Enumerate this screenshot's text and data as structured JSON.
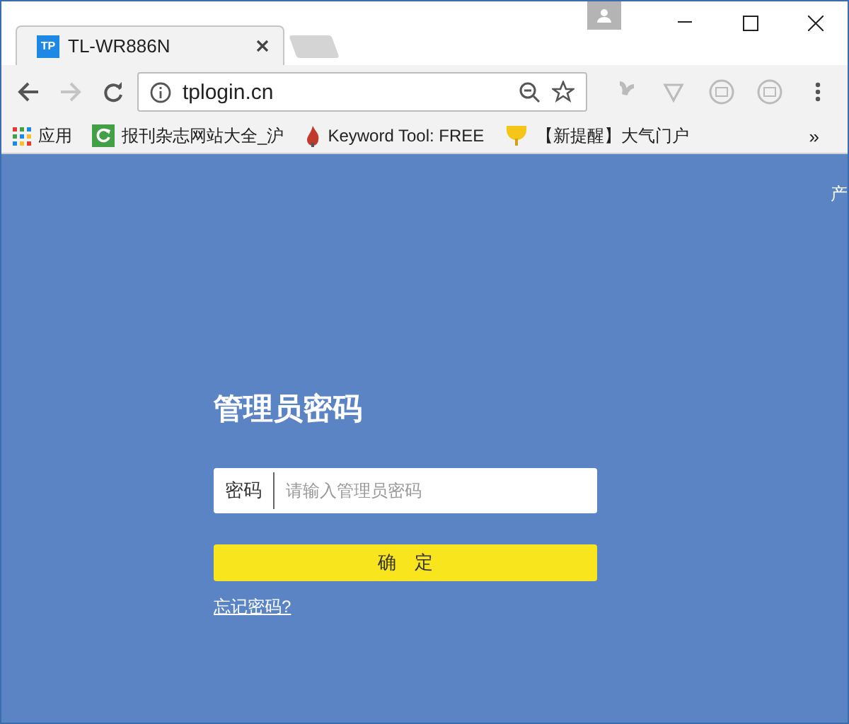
{
  "tabs": [
    {
      "label": "TL-WR886N",
      "favicon": "TP",
      "selected": true
    }
  ],
  "toolbar": {
    "back_disabled": false,
    "forward_disabled": true,
    "url": "tplogin.cn"
  },
  "bookmarks": [
    {
      "kind": "apps",
      "label": "应用"
    },
    {
      "kind": "refresh",
      "label": "报刊杂志网站大全_沪"
    },
    {
      "kind": "flame",
      "label": "Keyword Tool: FREE"
    },
    {
      "kind": "trophy",
      "label": "【新提醒】大气门户"
    }
  ],
  "bookmarks_more": "»",
  "page": {
    "corner_text": "产",
    "title": "管理员密码",
    "field_label": "密码",
    "placeholder": "请输入管理员密码",
    "submit": "确　定",
    "forgot_link": "忘记密码?"
  }
}
